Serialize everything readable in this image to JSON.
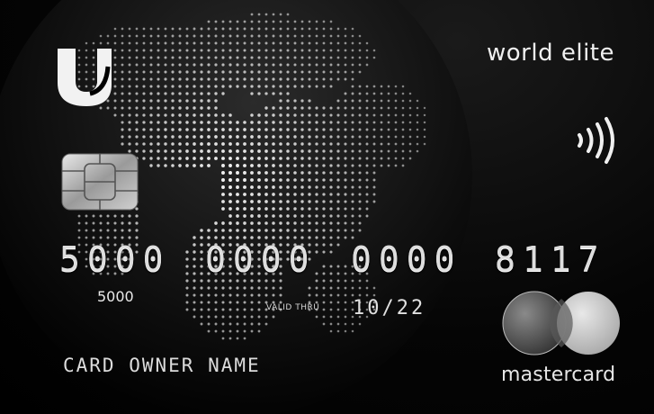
{
  "card": {
    "tier": "world elite",
    "number_groups": [
      "5000",
      "0000",
      "0000",
      "8117"
    ],
    "number_below": "5000",
    "valid_label": "VALID  THRU",
    "expiry": "10/22",
    "owner_name": "CARD OWNER NAME",
    "network": "mastercard",
    "logo_letter": "U",
    "icons": {
      "logo": "u-bank-logo",
      "contactless": "contactless-icon",
      "chip": "emv-chip-icon",
      "network_logo": "mastercard-logo"
    },
    "colors": {
      "background": "#000000",
      "text": "#e8e8e8",
      "globe_dots": "#ffffff"
    }
  }
}
